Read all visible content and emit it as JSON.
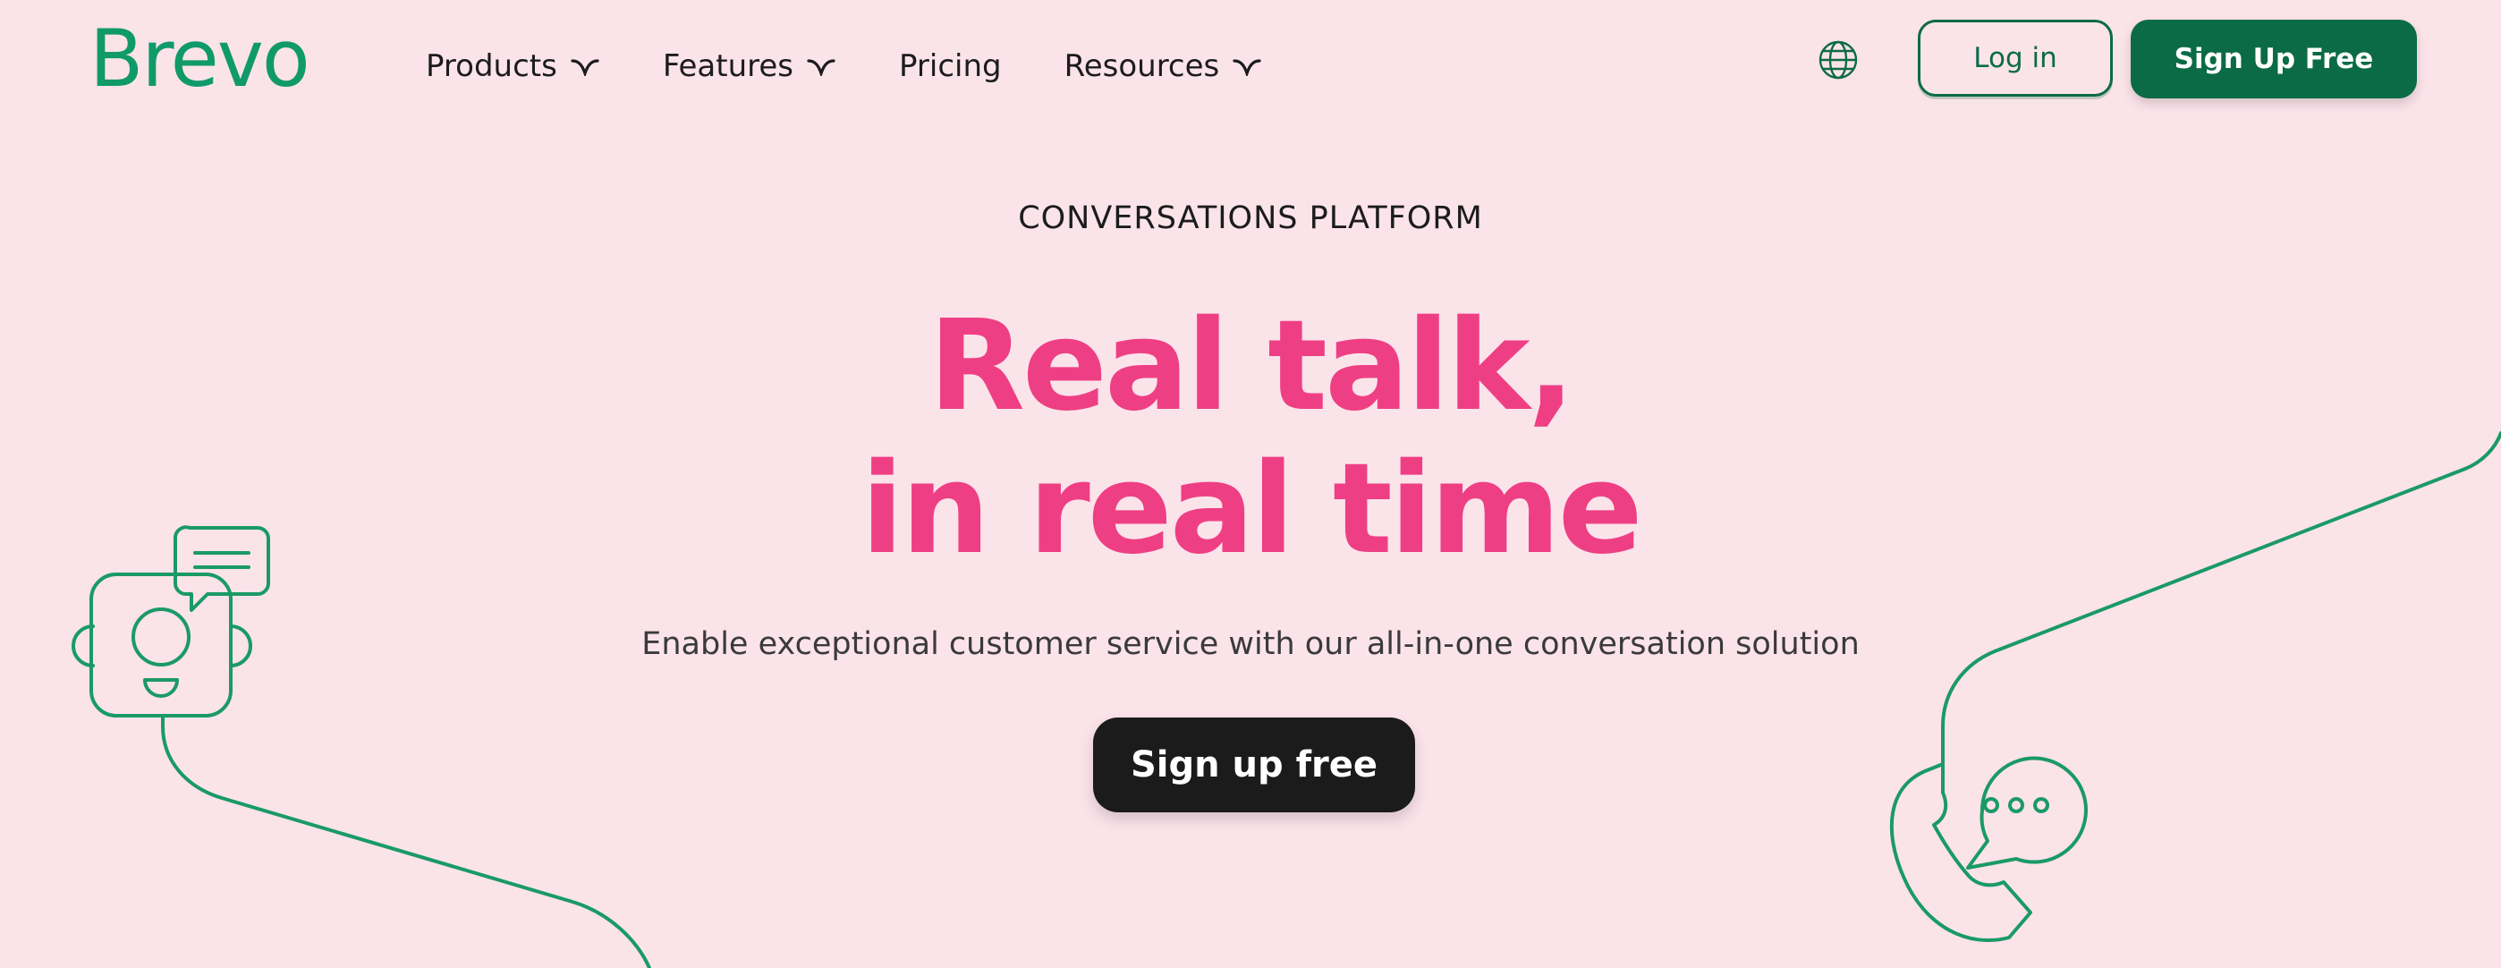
{
  "header": {
    "logo_text": "Brevo",
    "nav": [
      {
        "label": "Products",
        "has_dropdown": true
      },
      {
        "label": "Features",
        "has_dropdown": true
      },
      {
        "label": "Pricing",
        "has_dropdown": false
      },
      {
        "label": "Resources",
        "has_dropdown": true
      }
    ],
    "language_icon": "globe-icon",
    "login_label": "Log in",
    "signup_label": "Sign Up Free"
  },
  "hero": {
    "eyebrow": "CONVERSATIONS PLATFORM",
    "headline_line1": "Real talk,",
    "headline_line2": "in real time",
    "subtitle": "Enable exceptional customer service with our all-in-one conversation solution",
    "cta_label": "Sign up free"
  },
  "illustrations": {
    "left": "chat-agent-icon",
    "right": "phone-chat-icon"
  },
  "colors": {
    "background": "#fbe3ea",
    "brand_green": "#0b6b47",
    "logo_green": "#109a6a",
    "headline_pink": "#ef3f84",
    "cta_dark": "#1b1b1b"
  }
}
